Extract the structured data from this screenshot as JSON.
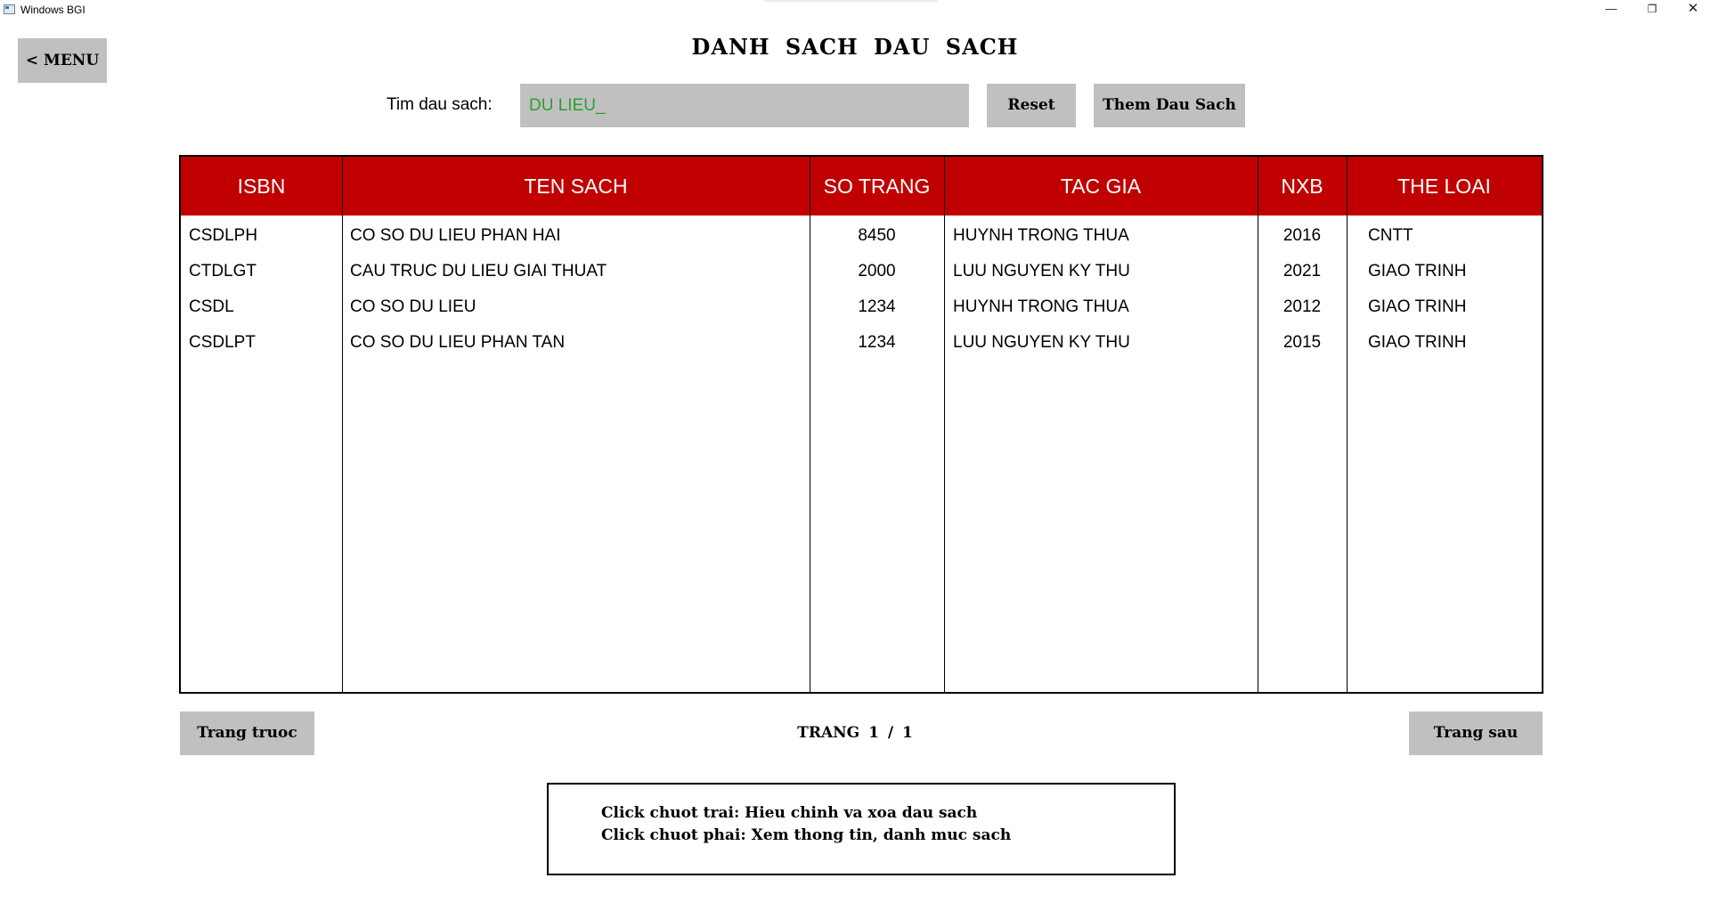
{
  "window": {
    "title": "Windows BGI",
    "controls": {
      "minimize": "—",
      "maximize": "❐",
      "close": "✕"
    }
  },
  "header": {
    "menu_label": "< MENU",
    "page_title": "DANH SACH DAU SACH"
  },
  "search": {
    "label": "Tim dau sach:",
    "value": "DU LIEU_",
    "text_color": "#2aa12a"
  },
  "toolbar": {
    "reset_label": "Reset",
    "add_label": "Them Dau Sach"
  },
  "table": {
    "header_color": "#c00000",
    "columns": [
      "ISBN",
      "TEN SACH",
      "SO TRANG",
      "TAC GIA",
      "NXB",
      "THE LOAI"
    ],
    "rows": [
      [
        "CSDLPH",
        "CO SO DU LIEU PHAN HAI",
        "8450",
        "HUYNH TRONG THUA",
        "2016",
        "CNTT"
      ],
      [
        "CTDLGT",
        "CAU TRUC DU LIEU GIAI THUAT",
        "2000",
        "LUU NGUYEN KY THU",
        "2021",
        "GIAO TRINH"
      ],
      [
        "CSDL",
        "CO SO DU LIEU",
        "1234",
        "HUYNH TRONG THUA",
        "2012",
        "GIAO TRINH"
      ],
      [
        "CSDLPT",
        "CO SO DU LIEU PHAN TAN",
        "1234",
        "LUU NGUYEN KY THU",
        "2015",
        "GIAO TRINH"
      ]
    ]
  },
  "pagination": {
    "prev_label": "Trang truoc",
    "next_label": "Trang sau",
    "indicator": "TRANG 1 / 1"
  },
  "help": {
    "line1": "Click chuot trai: Hieu chinh va xoa dau sach",
    "line2": "Click chuot phai: Xem thong tin, danh muc sach"
  }
}
